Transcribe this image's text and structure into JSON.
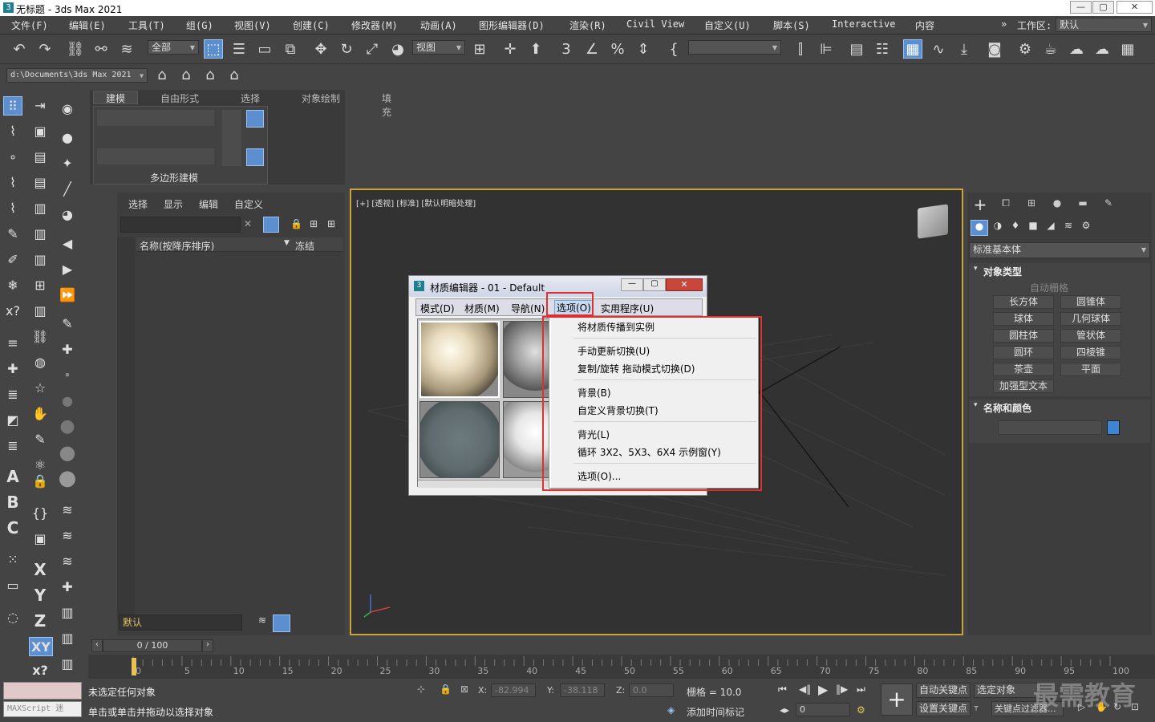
{
  "window": {
    "title": "无标题 - 3ds Max 2021",
    "controls": [
      "—",
      "▢",
      "✕"
    ]
  },
  "menubar": {
    "items": [
      "文件(F)",
      "编辑(E)",
      "工具(T)",
      "组(G)",
      "视图(V)",
      "创建(C)",
      "修改器(M)",
      "动画(A)",
      "图形编辑器(D)",
      "渲染(R)",
      "Civil View",
      "自定义(U)",
      "脚本(S)",
      "Interactive",
      "内容"
    ],
    "workspace_label": "工作区:",
    "workspace_value": "默认"
  },
  "toolbar": {
    "selection_filter": "全部",
    "ref_coord": "视图",
    "named_selection": ""
  },
  "project": {
    "path": "d:\\Documents\\3ds Max 2021"
  },
  "ribbon": {
    "tabs": [
      "建模",
      "自由形式",
      "选择",
      "对象绘制",
      "填充"
    ],
    "active_tab": "建模",
    "group_label": "多边形建模"
  },
  "scene_explorer": {
    "tabs": [
      "选择",
      "显示",
      "编辑",
      "自定义"
    ],
    "column_name": "名称(按降序排序)",
    "column_frozen": "冻结",
    "layer": "默认"
  },
  "viewport": {
    "label": "[+] [透视] [标准] [默认明暗处理]"
  },
  "material_editor": {
    "title": "材质编辑器 - 01 - Default",
    "menu": [
      "模式(D)",
      "材质(M)",
      "导航(N)",
      "选项(O)",
      "实用程序(U)"
    ],
    "active_menu": "选项(O)"
  },
  "options_menu": {
    "items": [
      "将材质传播到实例",
      "手动更新切换(U)",
      "复制/旋转 拖动模式切换(D)",
      "背景(B)",
      "自定义背景切换(T)",
      "背光(L)",
      "循环 3X2、5X3、6X4 示例窗(Y)",
      "选项(O)..."
    ]
  },
  "command_panel": {
    "category": "标准基本体",
    "rollout_object_type": "对象类型",
    "autogrid": "自动栅格",
    "buttons": [
      "长方体",
      "圆锥体",
      "球体",
      "几何球体",
      "圆柱体",
      "管状体",
      "圆环",
      "四棱锥",
      "茶壶",
      "平面",
      "加强型文本"
    ],
    "rollout_name_color": "名称和颜色",
    "object_color": "#3d86d6"
  },
  "timeline": {
    "frame": "0 / 100",
    "ticks": [
      "0",
      "5",
      "10",
      "15",
      "20",
      "25",
      "30",
      "35",
      "40",
      "45",
      "50",
      "55",
      "60",
      "65",
      "70",
      "75",
      "80",
      "85",
      "90",
      "95",
      "100"
    ]
  },
  "status": {
    "maxscript": "MAXScript 迷",
    "line1": "未选定任何对象",
    "line2": "单击或单击并拖动以选择对象",
    "x_label": "X:",
    "x_value": "-82.994",
    "y_label": "Y:",
    "y_value": "-38.118",
    "z_label": "Z:",
    "z_value": "0.0",
    "grid": "栅格 = 10.0",
    "add_time_tag": "添加时间标记",
    "auto_key": "自动关键点",
    "selected_objects": "选定对象",
    "set_key": "设置关键点",
    "key_filters": "关键点过滤器...",
    "current_frame": "0",
    "watermark": "最需教育"
  }
}
